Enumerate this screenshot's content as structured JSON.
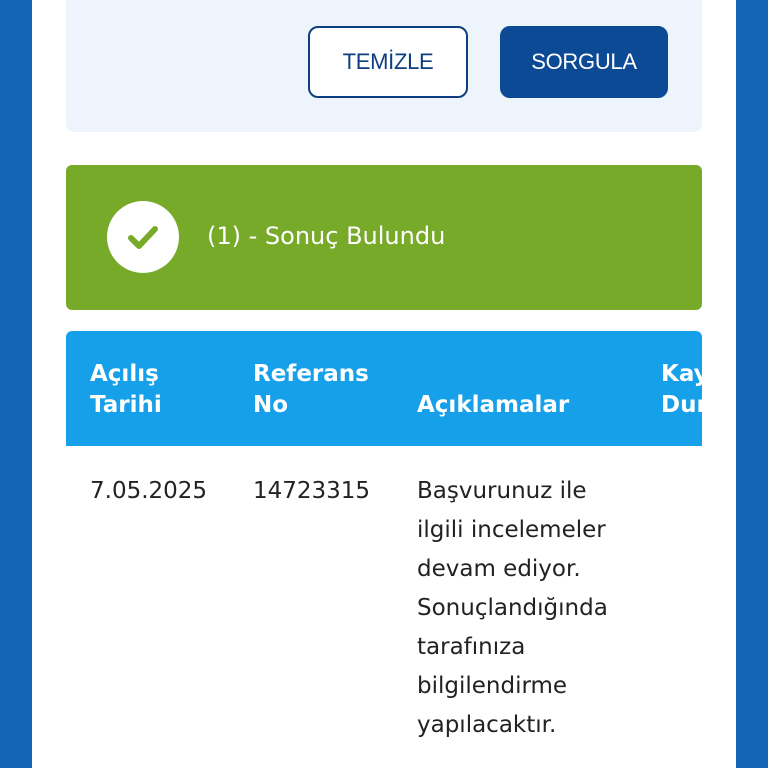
{
  "form": {
    "clear_label": "TEMİZLE",
    "query_label": "SORGULA"
  },
  "result": {
    "text": "(1) - Sonuç Bulundu",
    "icon": "check-icon"
  },
  "table": {
    "headers": [
      {
        "line1": "Açılış",
        "line2": "Tarihi"
      },
      {
        "line1": "Referans",
        "line2": "No"
      },
      {
        "line1": "",
        "line2": "Açıklamalar"
      },
      {
        "line1": "Kay",
        "line2": "Dur"
      }
    ],
    "rows": [
      {
        "date": "7.05.2025",
        "ref": "14723315",
        "desc_lines": [
          "Başvurunuz ile",
          "ilgili incelemeler",
          "devam ediyor.",
          "Sonuçlandığında",
          "tarafınıza",
          "bilgilendirme",
          "yapılacaktır."
        ]
      }
    ]
  },
  "colors": {
    "frame": "#1565b5",
    "panel": "#eef4fb",
    "primary_button": "#0c4a96",
    "success": "#78aa2a",
    "table_header": "#16a0ea"
  }
}
